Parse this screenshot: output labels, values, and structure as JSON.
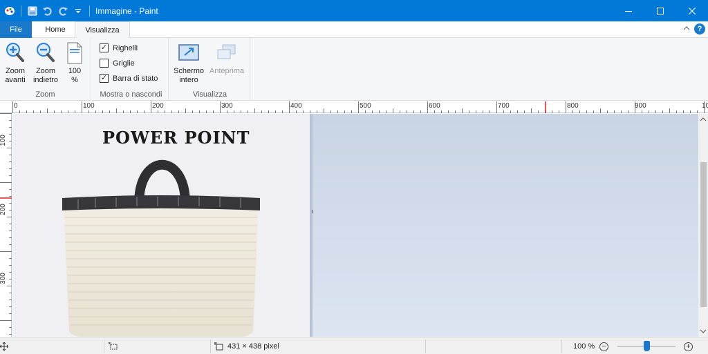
{
  "window": {
    "title": "Immagine - Paint"
  },
  "tabs": {
    "file": "File",
    "home": "Home",
    "view": "Visualizza"
  },
  "ribbon": {
    "zoom_group": {
      "label": "Zoom",
      "zoom_in": [
        "Zoom",
        "avanti"
      ],
      "zoom_out": [
        "Zoom",
        "indietro"
      ],
      "zoom_100": [
        "100",
        "%"
      ]
    },
    "show_group": {
      "label": "Mostra o nascondi",
      "rulers": {
        "label": "Righelli",
        "checked": true
      },
      "grid": {
        "label": "Griglie",
        "checked": false
      },
      "statusbar": {
        "label": "Barra di stato",
        "checked": true
      }
    },
    "view_group": {
      "label": "Visualizza",
      "fullscreen": [
        "Schermo",
        "intero"
      ],
      "preview": "Anteprima"
    }
  },
  "rulers": {
    "top_labels": [
      "0",
      "100",
      "200",
      "300",
      "400",
      "500",
      "600",
      "700",
      "800",
      "900",
      "10"
    ],
    "left_labels": [
      "100",
      "200",
      "300"
    ]
  },
  "canvas": {
    "image_title": "POWER POINT"
  },
  "statusbar": {
    "image_size": "431 × 438 pixel",
    "zoom_level": "100 %"
  },
  "colors": {
    "accent": "#0078d7",
    "file_tab": "#1979ca",
    "workspace": "#c9d4e4"
  }
}
